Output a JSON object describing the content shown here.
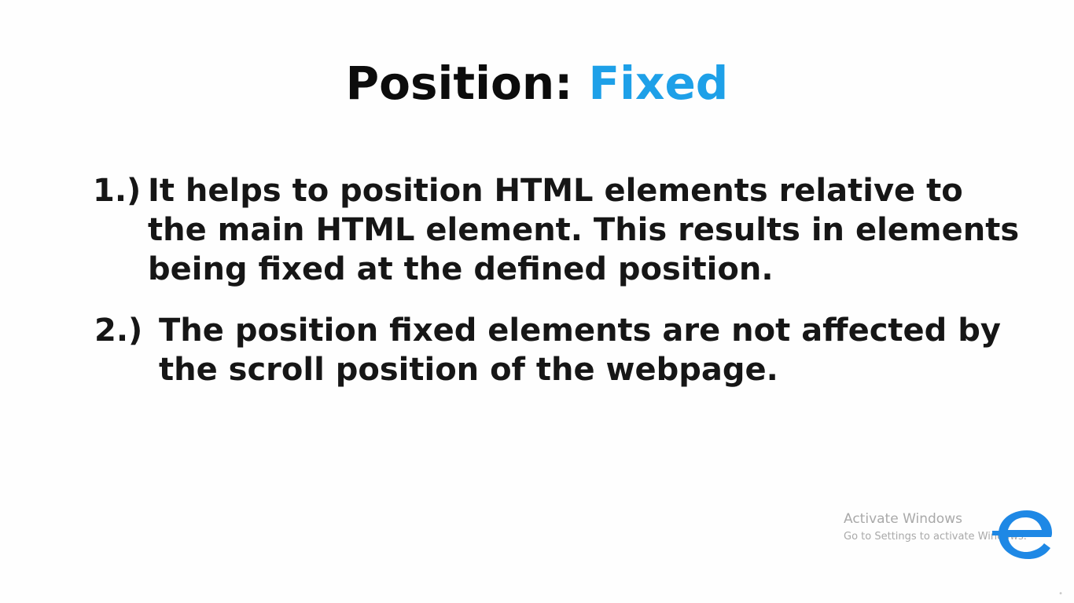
{
  "slide": {
    "title_prefix": "Position: ",
    "title_accent": "Fixed",
    "point1": {
      "number": "1.)",
      "lines": [
        "It helps to position HTML elements relative to",
        "the main HTML element. This results in elements",
        "being fixed at the defined position."
      ]
    },
    "point2": {
      "number": "2.)",
      "lines": [
        "The position fixed elements are not affected by",
        "the scroll position of the webpage."
      ]
    }
  },
  "watermark": {
    "title": "Activate Windows",
    "subtitle": "Go to Settings to activate Windows."
  },
  "logo": {
    "icon": "e-logo-icon",
    "color": "#1e88e5"
  },
  "colors": {
    "accent": "#1ea0e8",
    "text": "#161616"
  }
}
